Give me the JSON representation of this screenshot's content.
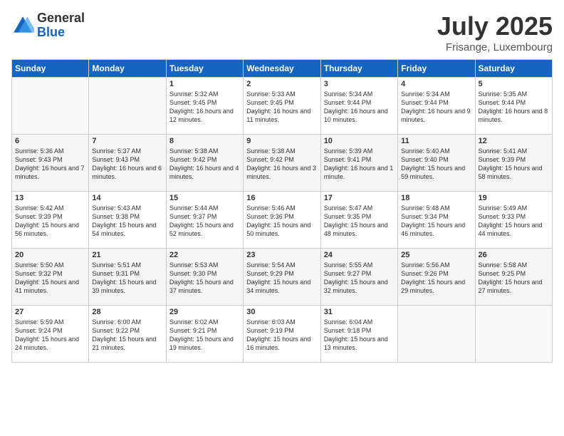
{
  "logo": {
    "general": "General",
    "blue": "Blue"
  },
  "title": "July 2025",
  "subtitle": "Frisange, Luxembourg",
  "days_of_week": [
    "Sunday",
    "Monday",
    "Tuesday",
    "Wednesday",
    "Thursday",
    "Friday",
    "Saturday"
  ],
  "weeks": [
    [
      {
        "day": "",
        "info": ""
      },
      {
        "day": "",
        "info": ""
      },
      {
        "day": "1",
        "info": "Sunrise: 5:32 AM\nSunset: 9:45 PM\nDaylight: 16 hours and 12 minutes."
      },
      {
        "day": "2",
        "info": "Sunrise: 5:33 AM\nSunset: 9:45 PM\nDaylight: 16 hours and 11 minutes."
      },
      {
        "day": "3",
        "info": "Sunrise: 5:34 AM\nSunset: 9:44 PM\nDaylight: 16 hours and 10 minutes."
      },
      {
        "day": "4",
        "info": "Sunrise: 5:34 AM\nSunset: 9:44 PM\nDaylight: 16 hours and 9 minutes."
      },
      {
        "day": "5",
        "info": "Sunrise: 5:35 AM\nSunset: 9:44 PM\nDaylight: 16 hours and 8 minutes."
      }
    ],
    [
      {
        "day": "6",
        "info": "Sunrise: 5:36 AM\nSunset: 9:43 PM\nDaylight: 16 hours and 7 minutes."
      },
      {
        "day": "7",
        "info": "Sunrise: 5:37 AM\nSunset: 9:43 PM\nDaylight: 16 hours and 6 minutes."
      },
      {
        "day": "8",
        "info": "Sunrise: 5:38 AM\nSunset: 9:42 PM\nDaylight: 16 hours and 4 minutes."
      },
      {
        "day": "9",
        "info": "Sunrise: 5:38 AM\nSunset: 9:42 PM\nDaylight: 16 hours and 3 minutes."
      },
      {
        "day": "10",
        "info": "Sunrise: 5:39 AM\nSunset: 9:41 PM\nDaylight: 16 hours and 1 minute."
      },
      {
        "day": "11",
        "info": "Sunrise: 5:40 AM\nSunset: 9:40 PM\nDaylight: 15 hours and 59 minutes."
      },
      {
        "day": "12",
        "info": "Sunrise: 5:41 AM\nSunset: 9:39 PM\nDaylight: 15 hours and 58 minutes."
      }
    ],
    [
      {
        "day": "13",
        "info": "Sunrise: 5:42 AM\nSunset: 9:39 PM\nDaylight: 15 hours and 56 minutes."
      },
      {
        "day": "14",
        "info": "Sunrise: 5:43 AM\nSunset: 9:38 PM\nDaylight: 15 hours and 54 minutes."
      },
      {
        "day": "15",
        "info": "Sunrise: 5:44 AM\nSunset: 9:37 PM\nDaylight: 15 hours and 52 minutes."
      },
      {
        "day": "16",
        "info": "Sunrise: 5:46 AM\nSunset: 9:36 PM\nDaylight: 15 hours and 50 minutes."
      },
      {
        "day": "17",
        "info": "Sunrise: 5:47 AM\nSunset: 9:35 PM\nDaylight: 15 hours and 48 minutes."
      },
      {
        "day": "18",
        "info": "Sunrise: 5:48 AM\nSunset: 9:34 PM\nDaylight: 15 hours and 46 minutes."
      },
      {
        "day": "19",
        "info": "Sunrise: 5:49 AM\nSunset: 9:33 PM\nDaylight: 15 hours and 44 minutes."
      }
    ],
    [
      {
        "day": "20",
        "info": "Sunrise: 5:50 AM\nSunset: 9:32 PM\nDaylight: 15 hours and 41 minutes."
      },
      {
        "day": "21",
        "info": "Sunrise: 5:51 AM\nSunset: 9:31 PM\nDaylight: 15 hours and 39 minutes."
      },
      {
        "day": "22",
        "info": "Sunrise: 5:53 AM\nSunset: 9:30 PM\nDaylight: 15 hours and 37 minutes."
      },
      {
        "day": "23",
        "info": "Sunrise: 5:54 AM\nSunset: 9:29 PM\nDaylight: 15 hours and 34 minutes."
      },
      {
        "day": "24",
        "info": "Sunrise: 5:55 AM\nSunset: 9:27 PM\nDaylight: 15 hours and 32 minutes."
      },
      {
        "day": "25",
        "info": "Sunrise: 5:56 AM\nSunset: 9:26 PM\nDaylight: 15 hours and 29 minutes."
      },
      {
        "day": "26",
        "info": "Sunrise: 5:58 AM\nSunset: 9:25 PM\nDaylight: 15 hours and 27 minutes."
      }
    ],
    [
      {
        "day": "27",
        "info": "Sunrise: 5:59 AM\nSunset: 9:24 PM\nDaylight: 15 hours and 24 minutes."
      },
      {
        "day": "28",
        "info": "Sunrise: 6:00 AM\nSunset: 9:22 PM\nDaylight: 15 hours and 21 minutes."
      },
      {
        "day": "29",
        "info": "Sunrise: 6:02 AM\nSunset: 9:21 PM\nDaylight: 15 hours and 19 minutes."
      },
      {
        "day": "30",
        "info": "Sunrise: 6:03 AM\nSunset: 9:19 PM\nDaylight: 15 hours and 16 minutes."
      },
      {
        "day": "31",
        "info": "Sunrise: 6:04 AM\nSunset: 9:18 PM\nDaylight: 15 hours and 13 minutes."
      },
      {
        "day": "",
        "info": ""
      },
      {
        "day": "",
        "info": ""
      }
    ]
  ]
}
